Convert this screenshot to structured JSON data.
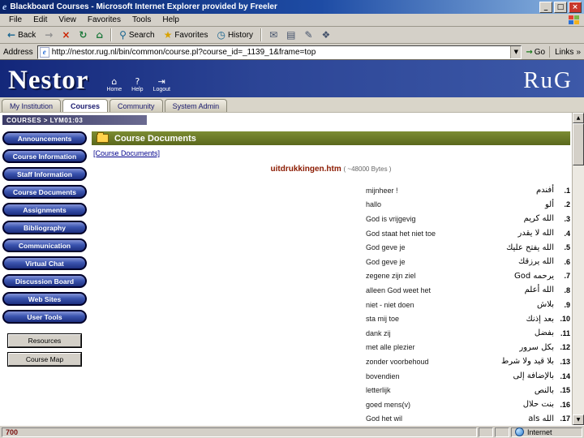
{
  "window": {
    "title": "Blackboard Courses - Microsoft Internet Explorer provided by Freeler",
    "controls": {
      "minimize": "_",
      "maximize": "□",
      "close": "×"
    }
  },
  "menu": {
    "items": [
      "File",
      "Edit",
      "View",
      "Favorites",
      "Tools",
      "Help"
    ]
  },
  "toolbar": {
    "back": {
      "icon": "←",
      "label": "Back"
    },
    "forward": {
      "icon": "→",
      "label": ""
    },
    "stop": {
      "icon": "×",
      "label": ""
    },
    "refresh": {
      "icon": "↻",
      "label": ""
    },
    "home": {
      "icon": "⌂",
      "label": ""
    },
    "search": {
      "icon": "⚲",
      "label": "Search"
    },
    "favorites": {
      "icon": "★",
      "label": "Favorites"
    },
    "history": {
      "icon": "◷",
      "label": "History"
    },
    "mail": {
      "icon": "✉",
      "label": ""
    },
    "print": {
      "icon": "▤",
      "label": ""
    },
    "edit": {
      "icon": "✎",
      "label": ""
    },
    "discuss": {
      "icon": "❖",
      "label": ""
    }
  },
  "address": {
    "label": "Address",
    "value": "http://nestor.rug.nl/bin/common/course.pl?course_id=_1139_1&frame=top",
    "go": "Go",
    "links": "Links",
    "links_chevron": "»"
  },
  "banner": {
    "logo": "Nestor",
    "brand": "RuG",
    "actions": [
      {
        "icon": "⌂",
        "label": "Home"
      },
      {
        "icon": "?",
        "label": "Help"
      },
      {
        "icon": "⇥",
        "label": "Logout"
      }
    ]
  },
  "tabs": [
    "My Institution",
    "Courses",
    "Community",
    "System Admin"
  ],
  "breadcrumb": "COURSES > LYM01:03",
  "sidebar": {
    "items": [
      "Announcements",
      "Course Information",
      "Staff Information",
      "Course Documents",
      "Assignments",
      "Bibliography",
      "Communication",
      "Virtual Chat",
      "Discussion Board",
      "Web Sites",
      "User Tools"
    ],
    "tools": [
      "Resources",
      "Course Map"
    ]
  },
  "content": {
    "title": "Course Documents",
    "folder_link": "[Course Documents]",
    "file_name": "uitdrukkingen.htm",
    "file_size": "( ~48000 Bytes )",
    "rows": [
      {
        "dutch": "mijnheer !",
        "arabic": "أفندم",
        "num": ".1"
      },
      {
        "dutch": "hallo",
        "arabic": "ألو",
        "num": ".2"
      },
      {
        "dutch": "God is vrijgevig",
        "arabic": "الله كريم",
        "num": ".3"
      },
      {
        "dutch": "God staat het niet toe",
        "arabic": "الله لا يقدر",
        "num": ".4"
      },
      {
        "dutch": "God geve je",
        "arabic": "الله يفتح عليك",
        "num": ".5"
      },
      {
        "dutch": "God geve je",
        "arabic": "الله يرزقك",
        "num": ".6"
      },
      {
        "dutch": "zegene zijn ziel",
        "arabic": "God يرحمه",
        "num": ".7"
      },
      {
        "dutch": "alleen God weet het",
        "arabic": "الله أعلم",
        "num": ".8"
      },
      {
        "dutch": "niet - niet doen",
        "arabic": "بلاش",
        "num": ".9"
      },
      {
        "dutch": "sta mij toe",
        "arabic": "بعد إذنك",
        "num": ".10"
      },
      {
        "dutch": "dank zij",
        "arabic": "بفضل",
        "num": ".11"
      },
      {
        "dutch": "met alle plezier",
        "arabic": "بكل سرور",
        "num": ".12"
      },
      {
        "dutch": "zonder voorbehoud",
        "arabic": "بلا قيد ولا شرط",
        "num": ".13"
      },
      {
        "dutch": "bovendien",
        "arabic": "بالإضافة إلى",
        "num": ".14"
      },
      {
        "dutch": "letterlijk",
        "arabic": "بالنص",
        "num": ".15"
      },
      {
        "dutch": "goed mens(v)",
        "arabic": "بنت حلال",
        "num": ".16"
      },
      {
        "dutch": "God het wil",
        "arabic": "als الله",
        "num": ".17"
      }
    ]
  },
  "statusbar": {
    "left": "700",
    "zone": "Internet"
  },
  "colors": {
    "titlebar": "#0a246a",
    "banner_blue": "#2c4596",
    "sidebar_button": "#2a3f9e",
    "content_header_olive": "#68761f",
    "link_navy": "#00008b",
    "file_maroon": "#8b1a00"
  }
}
